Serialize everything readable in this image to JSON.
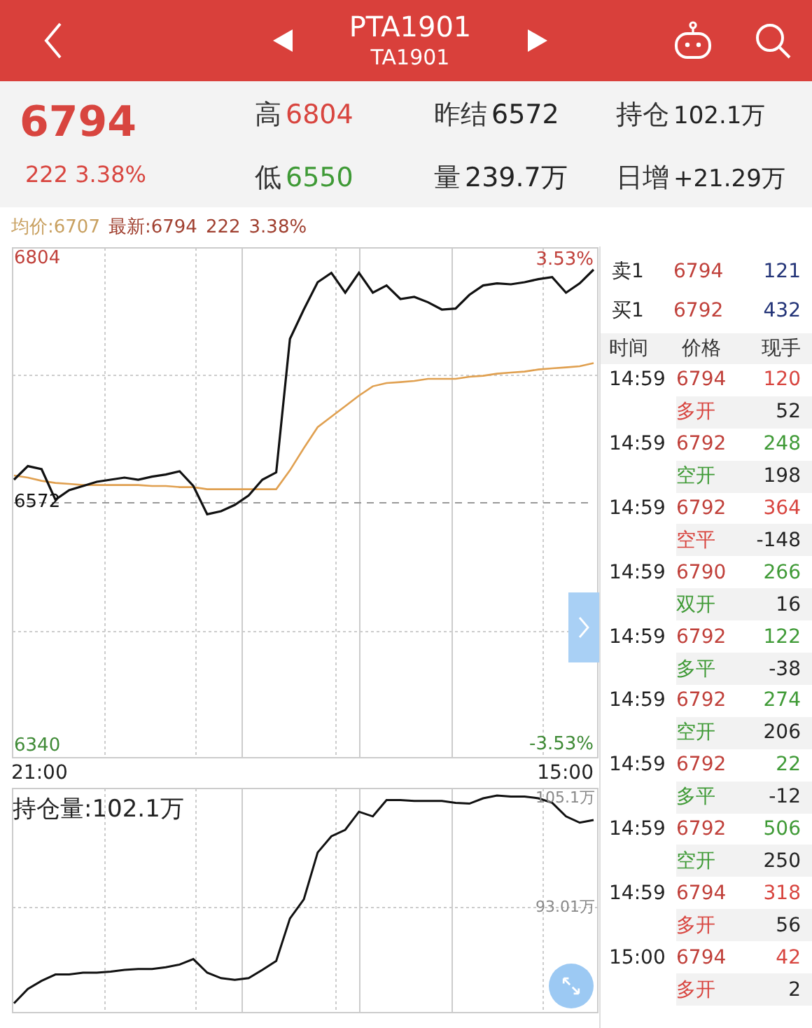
{
  "header": {
    "title": "PTA1901",
    "subtitle": "TA1901"
  },
  "quote": {
    "price": "6794",
    "change": "222 3.38%",
    "stats": [
      {
        "label": "高",
        "value": "6804",
        "color": "#d8453f"
      },
      {
        "label": "昨结",
        "value": "6572",
        "color": "#222222"
      },
      {
        "label": "持仓",
        "value": "102.1万",
        "color": "#222222"
      },
      {
        "label": "低",
        "value": "6550",
        "color": "#3f9a36"
      },
      {
        "label": "量",
        "value": "239.7万",
        "color": "#222222"
      },
      {
        "label": "日增",
        "value": "+21.29万",
        "color": "#222222"
      }
    ]
  },
  "info_line": {
    "average": "均价:6707",
    "latest": "最新:6794",
    "change": "222",
    "percent": "3.38%"
  },
  "price_chart": {
    "top_percent": "3.53%",
    "bottom_percent": "-3.53%",
    "start_time": "21:00",
    "end_time": "15:00",
    "chart_data": {
      "type": "line",
      "ylim": [
        6329.3,
        6814.7
      ],
      "yticks": [
        6804,
        6572,
        6340
      ],
      "series": [
        {
          "color": "#111111",
          "values": [
            6594,
            6607,
            6604,
            6575,
            6584,
            6588,
            6592,
            6594,
            6596,
            6594,
            6597,
            6599,
            6602,
            6588,
            6561,
            6564,
            6570,
            6579,
            6594,
            6601,
            6728,
            6756,
            6782,
            6791,
            6772,
            6791,
            6772,
            6779,
            6766,
            6768,
            6763,
            6756,
            6757,
            6770,
            6779,
            6781,
            6780,
            6782,
            6785,
            6787,
            6772,
            6781,
            6794
          ]
        },
        {
          "line_style": "dashed",
          "color": "#999999",
          "values": [
            6572,
            6572,
            6572,
            6572,
            6572,
            6572,
            6572,
            6572,
            6572,
            6572,
            6572,
            6572,
            6572,
            6572,
            6572,
            6572,
            6572,
            6572,
            6572,
            6572,
            6572,
            6572,
            6572,
            6572,
            6572,
            6572,
            6572,
            6572,
            6572,
            6572,
            6572,
            6572,
            6572,
            6572,
            6572,
            6572,
            6572,
            6572,
            6572,
            6572,
            6572,
            6572,
            6572
          ]
        },
        {
          "color": "#e0a050",
          "values": [
            6598,
            6596,
            6593,
            6591,
            6590,
            6589,
            6589,
            6589,
            6589,
            6589,
            6588,
            6588,
            6587,
            6587,
            6585,
            6585,
            6585,
            6585,
            6585,
            6585,
            6603,
            6624,
            6644,
            6654,
            6664,
            6674,
            6683,
            6686,
            6687,
            6688,
            6690,
            6690,
            6690,
            6692,
            6693,
            6695,
            6696,
            6697,
            6699,
            6700,
            6701,
            6702,
            6705
          ]
        }
      ]
    }
  },
  "oi_chart": {
    "title": "持仓量:102.1万",
    "chart_data": {
      "type": "line",
      "ylim": [
        81.38,
        106.18
      ],
      "yticks": [
        {
          "value": 105.1,
          "label": "105.1万"
        },
        {
          "value": 93.01,
          "label": "93.01万"
        }
      ],
      "series": [
        {
          "color": "#111111",
          "values": [
            82.4,
            84.0,
            84.9,
            85.6,
            85.6,
            85.8,
            85.8,
            85.9,
            86.1,
            86.2,
            86.2,
            86.4,
            86.7,
            87.3,
            85.8,
            85.2,
            85.0,
            85.2,
            86.1,
            87.1,
            91.8,
            93.9,
            99.1,
            100.9,
            101.6,
            103.6,
            103.1,
            104.9,
            104.9,
            104.8,
            104.8,
            104.8,
            104.6,
            104.5,
            105.1,
            105.4,
            105.3,
            105.3,
            105.1,
            104.6,
            103.1,
            102.4,
            102.7
          ]
        }
      ]
    }
  },
  "order_book": [
    {
      "label": "卖1",
      "price": "6794",
      "volume": "121"
    },
    {
      "label": "买1",
      "price": "6792",
      "volume": "432"
    }
  ],
  "trade_columns": [
    "时间",
    "价格",
    "现手"
  ],
  "trades": [
    {
      "time": "14:59",
      "price": "6794",
      "volume": {
        "text": "120",
        "color": "#d8453f"
      },
      "type": {
        "text": "多开",
        "color": "#d8453f"
      },
      "change": "52"
    },
    {
      "time": "14:59",
      "price": "6792",
      "volume": {
        "text": "248",
        "color": "#3f9a36"
      },
      "type": {
        "text": "空开",
        "color": "#3f9a36"
      },
      "change": "198"
    },
    {
      "time": "14:59",
      "price": "6792",
      "volume": {
        "text": "364",
        "color": "#d8453f"
      },
      "type": {
        "text": "空平",
        "color": "#d8453f"
      },
      "change": "-148"
    },
    {
      "time": "14:59",
      "price": "6790",
      "volume": {
        "text": "266",
        "color": "#3f9a36"
      },
      "type": {
        "text": "双开",
        "color": "#3f9a36"
      },
      "change": "16"
    },
    {
      "time": "14:59",
      "price": "6792",
      "volume": {
        "text": "122",
        "color": "#3f9a36"
      },
      "type": {
        "text": "多平",
        "color": "#3f9a36"
      },
      "change": "-38"
    },
    {
      "time": "14:59",
      "price": "6792",
      "volume": {
        "text": "274",
        "color": "#3f9a36"
      },
      "type": {
        "text": "空开",
        "color": "#3f9a36"
      },
      "change": "206"
    },
    {
      "time": "14:59",
      "price": "6792",
      "volume": {
        "text": "22",
        "color": "#3f9a36"
      },
      "type": {
        "text": "多平",
        "color": "#3f9a36"
      },
      "change": "-12"
    },
    {
      "time": "14:59",
      "price": "6792",
      "volume": {
        "text": "506",
        "color": "#3f9a36"
      },
      "type": {
        "text": "空开",
        "color": "#3f9a36"
      },
      "change": "250"
    },
    {
      "time": "14:59",
      "price": "6794",
      "volume": {
        "text": "318",
        "color": "#d8453f"
      },
      "type": {
        "text": "多开",
        "color": "#d8453f"
      },
      "change": "56"
    },
    {
      "time": "15:00",
      "price": "6794",
      "volume": {
        "text": "42",
        "color": "#d8453f"
      },
      "type": {
        "text": "多开",
        "color": "#d8453f"
      },
      "change": "2"
    }
  ]
}
